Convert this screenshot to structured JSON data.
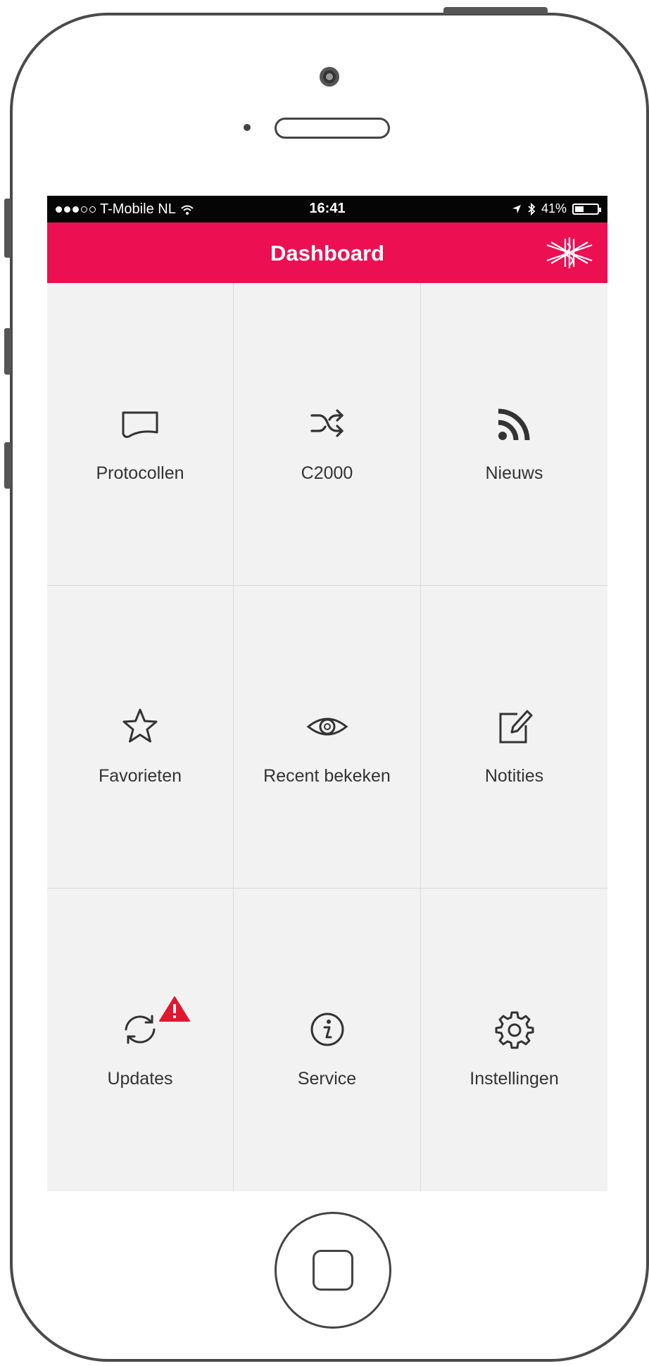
{
  "status_bar": {
    "carrier": "T-Mobile NL",
    "time": "16:41",
    "battery": "41%",
    "battery_level": 0.41,
    "icons": [
      "signal-dots-icon",
      "wifi-icon",
      "location-arrow-icon",
      "bluetooth-icon",
      "battery-icon"
    ]
  },
  "nav": {
    "title": "Dashboard",
    "logo_icon": "star-of-life-logo-icon"
  },
  "colors": {
    "accent": "#ec1052",
    "tile_bg": "#f2f2f2",
    "alert": "#e0182f"
  },
  "tiles": [
    {
      "label": "Protocollen",
      "icon": "document-icon"
    },
    {
      "label": "C2000",
      "icon": "shuffle-icon"
    },
    {
      "label": "Nieuws",
      "icon": "rss-icon"
    },
    {
      "label": "Favorieten",
      "icon": "star-icon"
    },
    {
      "label": "Recent bekeken",
      "icon": "eye-icon"
    },
    {
      "label": "Notities",
      "icon": "edit-note-icon"
    },
    {
      "label": "Updates",
      "icon": "sync-icon",
      "badge_icon": "warning-icon"
    },
    {
      "label": "Service",
      "icon": "info-icon"
    },
    {
      "label": "Instellingen",
      "icon": "gear-icon"
    }
  ]
}
